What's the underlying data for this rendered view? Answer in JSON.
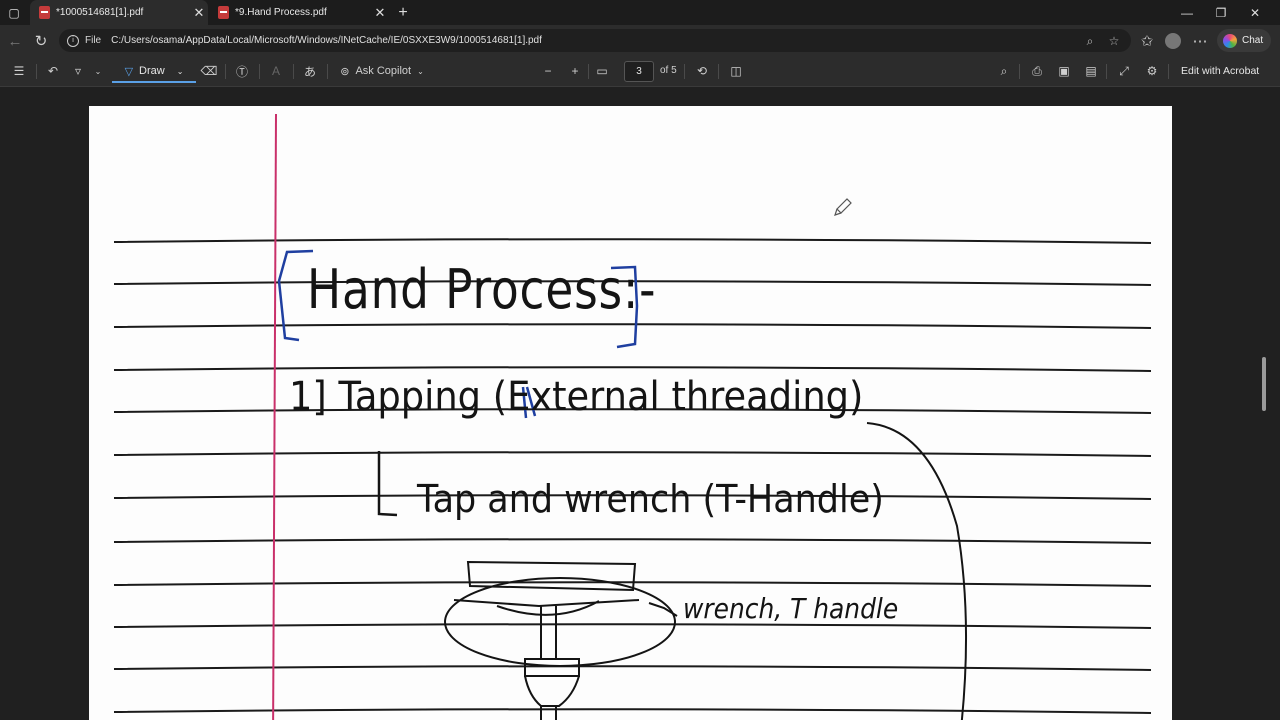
{
  "tabs": [
    {
      "title": "*1000514681[1].pdf",
      "active": true
    },
    {
      "title": "*9.Hand Process.pdf",
      "active": false
    }
  ],
  "address": {
    "scheme": "File",
    "url": "C:/Users/osama/AppData/Local/Microsoft/Windows/INetCache/IE/0SXXE3W9/1000514681[1].pdf"
  },
  "chat_label": "Chat",
  "toolbar": {
    "draw_label": "Draw",
    "ask_copilot_label": "Ask Copilot",
    "page_number": "3",
    "page_total": "of 5",
    "edit_acrobat_label": "Edit with Acrobat"
  },
  "notes": {
    "title": "Hand Process:-",
    "line1": "1] Tapping (External threading)",
    "line2": "Tap and wrench (T-Handle)",
    "label": "wrench, T handle"
  },
  "colors": {
    "margin_line": "#c9306a",
    "ruled_line": "#1a1a1a",
    "ink_blue": "#1f3fa0",
    "ink_black": "#141414"
  }
}
